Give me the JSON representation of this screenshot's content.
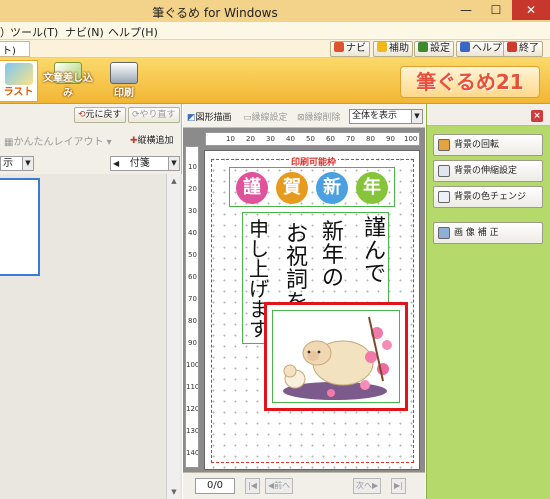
{
  "window": {
    "title": "筆ぐるめ for Windows",
    "min_glyph": "—",
    "max_glyph": "☐",
    "close_glyph": "✕"
  },
  "menu": {
    "items": [
      "ツール(T)",
      "ナビ(N)",
      "ヘルプ(H)"
    ],
    "left_fragment": "）"
  },
  "helper_bar": {
    "tab_fragment": "ト)",
    "buttons": [
      {
        "label": "ナビ",
        "icon": "wand-icon",
        "color": "#e0522e"
      },
      {
        "label": "補助",
        "icon": "star-icon",
        "color": "#f0b818"
      },
      {
        "label": "設定",
        "icon": "magnifier-icon",
        "color": "#3e8a2e"
      },
      {
        "label": "ヘルプ",
        "icon": "question-icon",
        "color": "#3a66c8"
      },
      {
        "label": "終了",
        "icon": "close-icon",
        "color": "#d13b2e"
      }
    ]
  },
  "toolbar": {
    "buttons": [
      {
        "label": "ラスト",
        "icon": "illust-icon"
      },
      {
        "label": "文章差し込み",
        "icon": "insert-text-icon"
      },
      {
        "label": "印刷",
        "icon": "printer-icon"
      }
    ],
    "logo": "筆ぐるめ21"
  },
  "left_panel": {
    "undo_label": "元に戻す",
    "redo_label": "やり直す",
    "easy_layout_label": "かんたんレイアウト",
    "add_text_label": "縦横追加",
    "view_label": "示",
    "sort_label": "付箋"
  },
  "center": {
    "tools": {
      "draw_shape": "図形描画",
      "border_setting": "縁線設定",
      "border_delete": "縁線削除"
    },
    "zoom_select": "全体を表示",
    "ruler_top": [
      "10",
      "20",
      "30",
      "40",
      "50",
      "60",
      "70",
      "80",
      "90",
      "100"
    ],
    "ruler_left": [
      "10",
      "20",
      "30",
      "40",
      "50",
      "60",
      "70",
      "80",
      "90",
      "100",
      "110",
      "120",
      "130",
      "140"
    ],
    "print_area_label": "印刷可能枠",
    "greeting_chars": [
      {
        "char": "謹",
        "color": "#e0539a"
      },
      {
        "char": "賀",
        "color": "#e69a1e"
      },
      {
        "char": "新",
        "color": "#4aa0e0"
      },
      {
        "char": "年",
        "color": "#86c43a"
      }
    ],
    "message_columns": [
      "謹んで",
      "新年の",
      "お祝詞を",
      "申し上げます"
    ],
    "page_indicator": "0/0",
    "prev_label": "前へ",
    "next_label": "次へ"
  },
  "right_panel": {
    "buttons": [
      "背景の回転",
      "背景の伸縮設定",
      "背景の色チェンジ",
      "画 像 補 正"
    ]
  }
}
